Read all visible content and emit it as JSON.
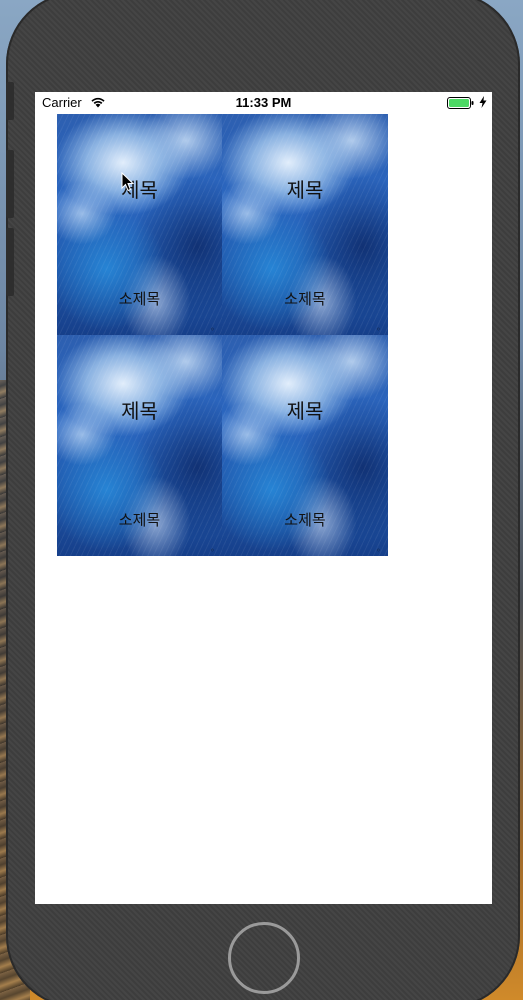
{
  "status_bar": {
    "carrier": "Carrier",
    "time": "11:33 PM",
    "battery_color": "#4cd964"
  },
  "cells": [
    {
      "title": "제목",
      "subtitle": "소제목"
    },
    {
      "title": "제목",
      "subtitle": "소제목"
    },
    {
      "title": "제목",
      "subtitle": "소제목"
    },
    {
      "title": "제목",
      "subtitle": "소제목"
    }
  ],
  "icons": {
    "wifi": "wifi-icon",
    "battery": "battery-icon",
    "charging": "bolt-icon",
    "cursor": "cursor-icon"
  }
}
